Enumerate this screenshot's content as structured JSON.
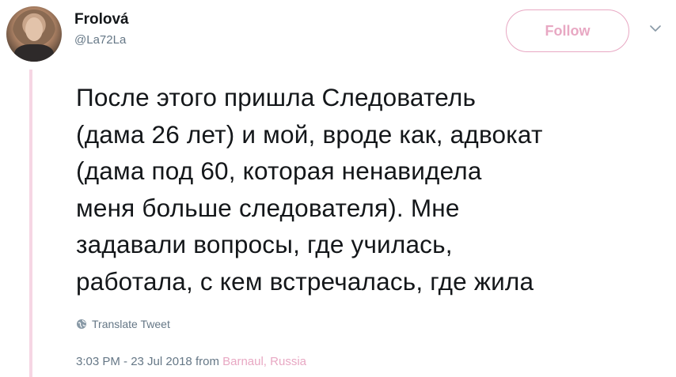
{
  "author": {
    "name": "Frolová",
    "handle": "@La72La"
  },
  "actions": {
    "follow_label": "Follow"
  },
  "tweet": {
    "text": "После этого пришла Следователь\n(дама 26 лет) и мой, вроде как, адвокат\n(дама под 60, которая ненавидела\nменя больше следователя). Мне\nзадавали вопросы, где училась,\nработала, с кем встречалась, где жила",
    "translate_label": "Translate Tweet",
    "time": "3:03 PM - 23 Jul 2018",
    "from_label": "from",
    "location": "Barnaul, Russia"
  },
  "icons": {
    "more": "chevron-down-icon",
    "translate": "globe-icon"
  },
  "colors": {
    "accent": "#e8a8c3",
    "thread_line": "#f6d6e4",
    "text": "#14171a",
    "secondary": "#657786"
  }
}
